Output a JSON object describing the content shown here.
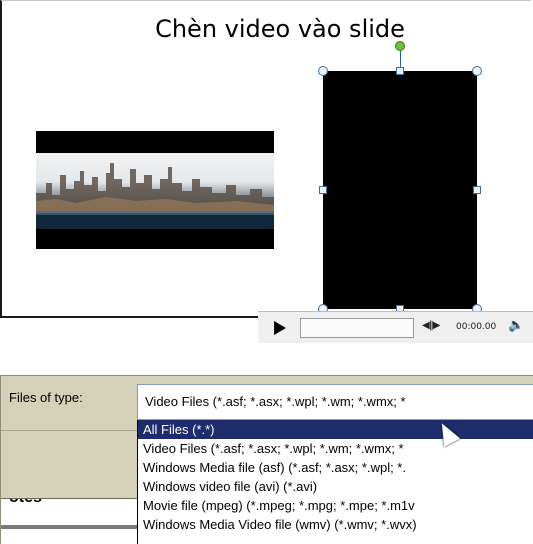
{
  "slide": {
    "title": "Chèn video vào slide"
  },
  "media_controls": {
    "play_icon": "play-icon",
    "seek_icon": "seek-icon",
    "seek_glyph": "◀‖▶",
    "time": "00:00.00",
    "volume_icon": "speaker-icon",
    "volume_glyph": "🔈"
  },
  "file_dialog": {
    "type_label": "Files of type:",
    "type_value": "Video Files (*.asf; *.asx; *.wpl; *.wm; *.wmx; *",
    "options": [
      "All Files (*.*)",
      "Video Files (*.asf; *.asx; *.wpl; *.wm; *.wmx; *",
      "Windows Media file (asf) (*.asf; *.asx; *.wpl; *.",
      "Windows video file (avi) (*.avi)",
      "Movie file (mpeg) (*.mpeg; *.mpg; *.mpe; *.m1v",
      "Windows Media Video file (wmv) (*.wmv; *.wvx)"
    ],
    "selected_index": 0,
    "left_fragment_text": "otes"
  }
}
